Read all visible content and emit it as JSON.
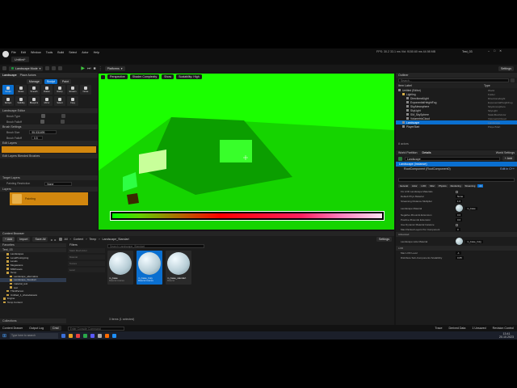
{
  "app": {
    "project_tab": "Untitled*",
    "window_title": "Test_03",
    "menu": [
      "File",
      "Edit",
      "Window",
      "Tools",
      "Build",
      "Select",
      "Actor",
      "Help"
    ],
    "stats": "FPS: 30.2  33.1 ms  Vid:  9150.60 ms  44.98 MB"
  },
  "toolbar": {
    "mode": "Landscape Mode",
    "platforms": "Platforms",
    "settings": "Settings"
  },
  "landscape_panel": {
    "title": "Landscape",
    "tab2": "Place Actors",
    "tabs": [
      "Manage",
      "Sculpt",
      "Paint"
    ],
    "tools": [
      "Sculpt",
      "Erase",
      "Smooth",
      "Flatten",
      "Ramp",
      "Erosion",
      "Noise",
      "Retopo",
      "Visibility",
      "Blueprint",
      "Mirror",
      "Select",
      "Copy"
    ],
    "sections": {
      "editor": "Landscape Editor",
      "brush_type": "Brush Type",
      "brush_falloff": "Brush Falloff",
      "brush_settings": "Brush Settings",
      "brush_size": "Brush Size",
      "brush_size_val": "95.531699",
      "brush_falloff_val": "0.5",
      "edit_layers": "Edit Layers",
      "edit_layers_blend": "Edit Layers Blended Brushes",
      "target_layers": "Target Layers",
      "painting_restriction": "Painting Restriction",
      "painting_restriction_val": "None",
      "layers": "Layers",
      "layer_name": "Painting"
    }
  },
  "viewport": {
    "perspective": "Perspective",
    "shader": "Shader Complexity",
    "show": "Show",
    "scalability": "Scalability: High"
  },
  "outliner": {
    "title": "Outliner",
    "search_placeholder": "Search...",
    "col_label": "Item Label",
    "col_type": "Type",
    "rows": [
      {
        "label": "Untitled (Editor)",
        "type": "World"
      },
      {
        "label": "Lighting",
        "type": "Folder"
      },
      {
        "label": "DirectionalLight",
        "type": "DirectionalLight"
      },
      {
        "label": "ExponentialHeightFog",
        "type": "ExponentialHeightFog"
      },
      {
        "label": "SkyAtmosphere",
        "type": "SkyAtmosphere"
      },
      {
        "label": "SkyLight",
        "type": "SkyLight"
      },
      {
        "label": "SM_SkySphere",
        "type": "StaticMeshActor"
      },
      {
        "label": "VolumetricCloud",
        "type": "VolumetricCloud"
      },
      {
        "label": "Landscape",
        "type": "Landscape"
      },
      {
        "label": "PlayerStart",
        "type": "PlayerStart"
      }
    ],
    "count": "8 actors"
  },
  "details": {
    "world_partition": "World Partition",
    "details_tab": "Details",
    "world_settings": "World Settings",
    "actor_name": "Landscape",
    "add": "+ Add",
    "instance": "Landscape (Instance)",
    "component": "RootComponent (RootComponent0)",
    "edit_cpp": "Edit in C++",
    "filter_tabs": [
      "General",
      "Actor",
      "LOD",
      "Misc",
      "Physics",
      "Rendering",
      "Streaming",
      "All"
    ],
    "props": [
      {
        "label": "Fix LOD Landscape Materials",
        "value": ""
      },
      {
        "label": "Default Phys Material",
        "value": "None"
      },
      {
        "label": "Streaming Distance Multiplier",
        "value": "1.0"
      },
      {
        "label": "Landscape Material",
        "value": "m_base"
      },
      {
        "label": "Negative Zbounds Extension",
        "value": "0.0"
      },
      {
        "label": "Positive Zbounds Extension",
        "value": "0.0"
      },
      {
        "label": "Use Dynamic Material Instance",
        "value": ""
      },
      {
        "label": "Max Painted Layers Per Component",
        "value": "0"
      },
      {
        "label": "Advanced",
        "value": ""
      },
      {
        "label": "Landscape Hole Material",
        "value": "m_base_holy"
      },
      {
        "label": "LOD",
        "value": ""
      },
      {
        "label": "Max LOD Level",
        "value": "-1"
      },
      {
        "label": "Distribute Sub-Components Scalability",
        "value": "0.65"
      }
    ]
  },
  "content_browser": {
    "title": "Content Browser",
    "add": "+ Add",
    "import": "Import",
    "save_all": "Save All",
    "settings": "Settings",
    "breadcrumb": [
      "All",
      "Content",
      "Temp",
      "Landscape_Standart"
    ],
    "favorites": "Favorites",
    "project": "Test_03",
    "tree": [
      "Landscapes",
      "LevelPrototyping",
      "Levels",
      "Megascans",
      "MSPresets",
      "Temp",
      "Landscape_alternative",
      "Landscape_Standart",
      "material_test",
      "test",
      "ThirdPerson",
      "Untitled_1_sharedassets",
      "Engine",
      "Temp Content"
    ],
    "filters": "Filters",
    "filter_items": [
      "Static Mesh Actor",
      "Material",
      "Texture",
      "Level"
    ],
    "search_placeholder": "Search Landscape_Standart",
    "assets": [
      {
        "name": "m_base",
        "type": "Material Instance"
      },
      {
        "name": "m_base_holy",
        "type": "Material Instance"
      },
      {
        "name": "m_base_standart",
        "type": "Material"
      }
    ],
    "count": "3 items (1 selected)",
    "collections": "Collections"
  },
  "statusbar": {
    "drawer": "Content Drawer",
    "output": "Output Log",
    "cmd": "Cmd",
    "console_placeholder": "Enter Console Command",
    "trace": "Trace",
    "derived": "Derived Data",
    "unsaved": "1 Unsaved",
    "revision": "Revision Control"
  },
  "taskbar": {
    "search_placeholder": "Type here to search",
    "time": "13:41",
    "date": "20.10.2023"
  },
  "colors": {
    "green_bright": "#1bff00",
    "green_mid": "#15d400",
    "green_dark": "#0a8a00",
    "layer_orange": "#d2870e",
    "select_blue": "#0a6fd0"
  }
}
